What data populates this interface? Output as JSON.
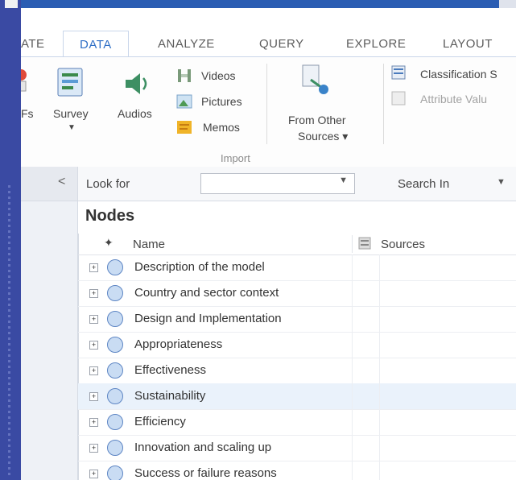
{
  "ribbon_tabs": [
    "ATE",
    "DATA",
    "ANALYZE",
    "QUERY",
    "EXPLORE",
    "LAYOUT"
  ],
  "ribbon": {
    "partial_label": "Fs",
    "survey": "Survey",
    "audios": "Audios",
    "videos": "Videos",
    "pictures": "Pictures",
    "memos": "Memos",
    "from_other_line1": "From Other",
    "from_other_line2": "Sources ▾",
    "group_import": "Import",
    "classification": "Classification S",
    "attribute_values": "Attribute Valu"
  },
  "nav": {
    "collapse_glyph": "<"
  },
  "find": {
    "look_for_label": "Look for",
    "look_for_value": "",
    "search_in_label": "Search In"
  },
  "nodes": {
    "title": "Nodes",
    "columns": {
      "name": "Name",
      "sources": "Sources"
    },
    "rows": [
      {
        "label": "Description of the model",
        "selected": false
      },
      {
        "label": "Country and sector context",
        "selected": false
      },
      {
        "label": "Design and Implementation",
        "selected": false
      },
      {
        "label": "Appropriateness",
        "selected": false
      },
      {
        "label": "Effectiveness",
        "selected": false
      },
      {
        "label": "Sustainability",
        "selected": true
      },
      {
        "label": "Efficiency",
        "selected": false
      },
      {
        "label": "Innovation and scaling up",
        "selected": false
      },
      {
        "label": "Success or failure reasons",
        "selected": false
      }
    ]
  },
  "colors": {
    "frame": "#2d3f96",
    "accent_tab": "#2f6fc6",
    "selected_row": "#eaf2fb",
    "node_circle": "#c9dcf3"
  }
}
